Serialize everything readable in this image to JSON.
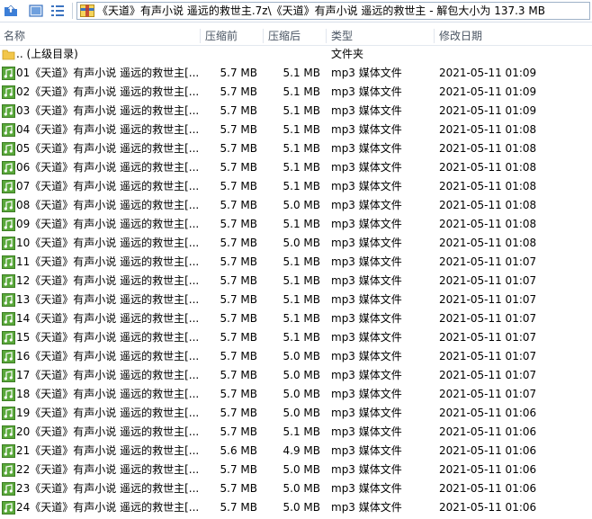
{
  "toolbar": {
    "path": "《天道》有声小说 遥远的救世主.7z\\《天道》有声小说 遥远的救世主 - 解包大小为 137.3 MB"
  },
  "columns": {
    "name": "名称",
    "size": "压缩前",
    "packed": "压缩后",
    "type": "类型",
    "modified": "修改日期"
  },
  "parent_row": {
    "name": ".. (上级目录)",
    "type": "文件夹"
  },
  "files": [
    {
      "name": "01《天道》有声小说 遥远的救世主[...",
      "size": "5.7 MB",
      "packed": "5.1 MB",
      "type": "mp3 媒体文件",
      "modified": "2021-05-11 01:09"
    },
    {
      "name": "02《天道》有声小说 遥远的救世主[...",
      "size": "5.7 MB",
      "packed": "5.1 MB",
      "type": "mp3 媒体文件",
      "modified": "2021-05-11 01:09"
    },
    {
      "name": "03《天道》有声小说 遥远的救世主[...",
      "size": "5.7 MB",
      "packed": "5.1 MB",
      "type": "mp3 媒体文件",
      "modified": "2021-05-11 01:09"
    },
    {
      "name": "04《天道》有声小说 遥远的救世主[...",
      "size": "5.7 MB",
      "packed": "5.1 MB",
      "type": "mp3 媒体文件",
      "modified": "2021-05-11 01:08"
    },
    {
      "name": "05《天道》有声小说 遥远的救世主[...",
      "size": "5.7 MB",
      "packed": "5.1 MB",
      "type": "mp3 媒体文件",
      "modified": "2021-05-11 01:08"
    },
    {
      "name": "06《天道》有声小说 遥远的救世主[...",
      "size": "5.7 MB",
      "packed": "5.1 MB",
      "type": "mp3 媒体文件",
      "modified": "2021-05-11 01:08"
    },
    {
      "name": "07《天道》有声小说 遥远的救世主[...",
      "size": "5.7 MB",
      "packed": "5.1 MB",
      "type": "mp3 媒体文件",
      "modified": "2021-05-11 01:08"
    },
    {
      "name": "08《天道》有声小说 遥远的救世主[...",
      "size": "5.7 MB",
      "packed": "5.0 MB",
      "type": "mp3 媒体文件",
      "modified": "2021-05-11 01:08"
    },
    {
      "name": "09《天道》有声小说 遥远的救世主[...",
      "size": "5.7 MB",
      "packed": "5.1 MB",
      "type": "mp3 媒体文件",
      "modified": "2021-05-11 01:08"
    },
    {
      "name": "10《天道》有声小说 遥远的救世主[...",
      "size": "5.7 MB",
      "packed": "5.0 MB",
      "type": "mp3 媒体文件",
      "modified": "2021-05-11 01:08"
    },
    {
      "name": "11《天道》有声小说 遥远的救世主[...",
      "size": "5.7 MB",
      "packed": "5.1 MB",
      "type": "mp3 媒体文件",
      "modified": "2021-05-11 01:07"
    },
    {
      "name": "12《天道》有声小说 遥远的救世主[...",
      "size": "5.7 MB",
      "packed": "5.1 MB",
      "type": "mp3 媒体文件",
      "modified": "2021-05-11 01:07"
    },
    {
      "name": "13《天道》有声小说 遥远的救世主[...",
      "size": "5.7 MB",
      "packed": "5.1 MB",
      "type": "mp3 媒体文件",
      "modified": "2021-05-11 01:07"
    },
    {
      "name": "14《天道》有声小说 遥远的救世主[...",
      "size": "5.7 MB",
      "packed": "5.1 MB",
      "type": "mp3 媒体文件",
      "modified": "2021-05-11 01:07"
    },
    {
      "name": "15《天道》有声小说 遥远的救世主[...",
      "size": "5.7 MB",
      "packed": "5.1 MB",
      "type": "mp3 媒体文件",
      "modified": "2021-05-11 01:07"
    },
    {
      "name": "16《天道》有声小说 遥远的救世主[...",
      "size": "5.7 MB",
      "packed": "5.0 MB",
      "type": "mp3 媒体文件",
      "modified": "2021-05-11 01:07"
    },
    {
      "name": "17《天道》有声小说 遥远的救世主[...",
      "size": "5.7 MB",
      "packed": "5.0 MB",
      "type": "mp3 媒体文件",
      "modified": "2021-05-11 01:07"
    },
    {
      "name": "18《天道》有声小说 遥远的救世主[...",
      "size": "5.7 MB",
      "packed": "5.0 MB",
      "type": "mp3 媒体文件",
      "modified": "2021-05-11 01:07"
    },
    {
      "name": "19《天道》有声小说 遥远的救世主[...",
      "size": "5.7 MB",
      "packed": "5.0 MB",
      "type": "mp3 媒体文件",
      "modified": "2021-05-11 01:06"
    },
    {
      "name": "20《天道》有声小说 遥远的救世主[...",
      "size": "5.7 MB",
      "packed": "5.1 MB",
      "type": "mp3 媒体文件",
      "modified": "2021-05-11 01:06"
    },
    {
      "name": "21《天道》有声小说 遥远的救世主[...",
      "size": "5.6 MB",
      "packed": "4.9 MB",
      "type": "mp3 媒体文件",
      "modified": "2021-05-11 01:06"
    },
    {
      "name": "22《天道》有声小说 遥远的救世主[...",
      "size": "5.7 MB",
      "packed": "5.0 MB",
      "type": "mp3 媒体文件",
      "modified": "2021-05-11 01:06"
    },
    {
      "name": "23《天道》有声小说 遥远的救世主[...",
      "size": "5.7 MB",
      "packed": "5.0 MB",
      "type": "mp3 媒体文件",
      "modified": "2021-05-11 01:06"
    },
    {
      "name": "24《天道》有声小说 遥远的救世主[...",
      "size": "5.7 MB",
      "packed": "5.0 MB",
      "type": "mp3 媒体文件",
      "modified": "2021-05-11 01:06"
    }
  ],
  "icons": {
    "up": "folder-up-icon",
    "view_large": "large-icons-view-icon",
    "view_list": "list-view-icon",
    "archive": "archive-icon",
    "folder": "folder-icon",
    "file": "mp3-file-icon"
  },
  "colors": {
    "folder": "#f2c64a",
    "mp3_icon": "#59a83a",
    "header_text": "#4a5563"
  }
}
